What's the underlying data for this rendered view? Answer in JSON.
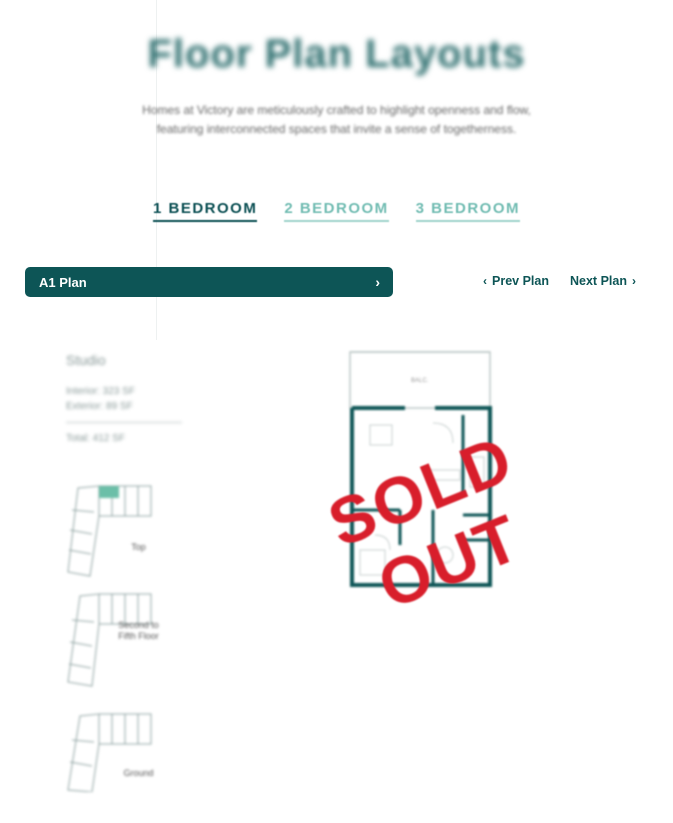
{
  "header": {
    "title": "Floor Plan Layouts",
    "subtitle_line1": "Homes at Victory are meticulously crafted to highlight openness and flow,",
    "subtitle_line2": "featuring interconnected spaces that invite a sense of togetherness."
  },
  "tabs": [
    {
      "label": "1 BEDROOM",
      "active": true
    },
    {
      "label": "2 BEDROOM",
      "active": false
    },
    {
      "label": "3 BEDROOM",
      "active": false
    }
  ],
  "plan_selector": {
    "label": "A1 Plan",
    "icon": "chevron-right-icon"
  },
  "navigation": {
    "prev_label": "Prev Plan",
    "next_label": "Next Plan"
  },
  "plan_info": {
    "unit_type": "Studio",
    "interior": "Interior: 323 SF",
    "exterior": "Exterior: 89 SF",
    "total": "Total: 412 SF"
  },
  "key_plans": [
    {
      "label": "Top"
    },
    {
      "label": "Second to Fifth Floor"
    },
    {
      "label": "Ground"
    }
  ],
  "floorplan": {
    "balcony_label": "BALC.",
    "stamp": "SOLD OUT"
  },
  "colors": {
    "primary": "#0d5556",
    "accent": "#71bcb2",
    "stamp": "#d81e2b"
  }
}
